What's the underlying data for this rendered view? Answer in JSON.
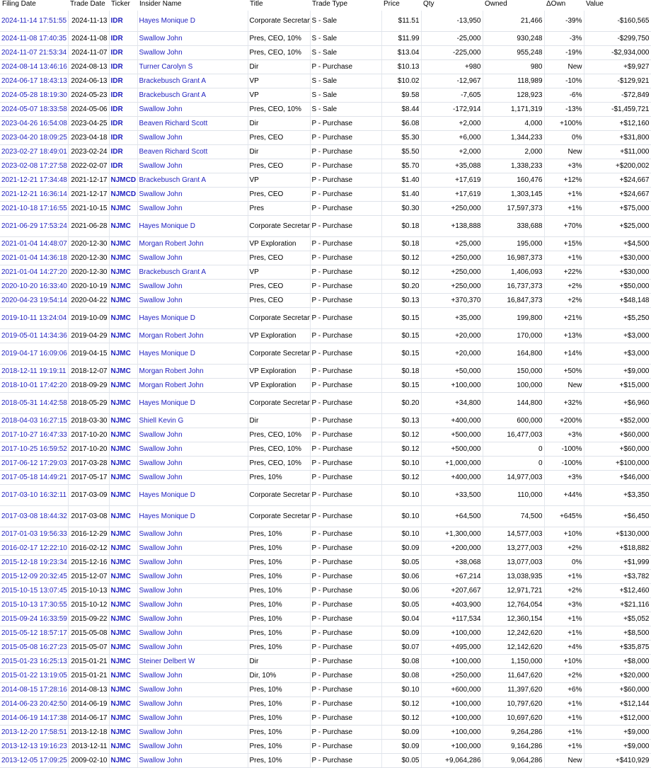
{
  "columns": [
    "Filing Date",
    "Trade Date",
    "Ticker",
    "Insider Name",
    "Title",
    "Trade Type",
    "Price",
    "Qty",
    "Owned",
    "ΔOwn",
    "Value"
  ],
  "rows": [
    [
      "2024-11-14 17:51:55",
      "2024-11-13",
      "IDR",
      "Hayes Monique D",
      "Corporate Secretary",
      "S - Sale",
      "$11.51",
      "-13,950",
      "21,466",
      "-39%",
      "-$160,565"
    ],
    [
      "2024-11-08 17:40:35",
      "2024-11-08",
      "IDR",
      "Swallow John",
      "Pres, CEO, 10%",
      "S - Sale",
      "$11.99",
      "-25,000",
      "930,248",
      "-3%",
      "-$299,750"
    ],
    [
      "2024-11-07 21:53:34",
      "2024-11-07",
      "IDR",
      "Swallow John",
      "Pres, CEO, 10%",
      "S - Sale",
      "$13.04",
      "-225,000",
      "955,248",
      "-19%",
      "-$2,934,000"
    ],
    [
      "2024-08-14 13:46:16",
      "2024-08-13",
      "IDR",
      "Turner Carolyn S",
      "Dir",
      "P - Purchase",
      "$10.13",
      "+980",
      "980",
      "New",
      "+$9,927"
    ],
    [
      "2024-06-17 18:43:13",
      "2024-06-13",
      "IDR",
      "Brackebusch Grant A",
      "VP",
      "S - Sale",
      "$10.02",
      "-12,967",
      "118,989",
      "-10%",
      "-$129,921"
    ],
    [
      "2024-05-28 18:19:30",
      "2024-05-23",
      "IDR",
      "Brackebusch Grant A",
      "VP",
      "S - Sale",
      "$9.58",
      "-7,605",
      "128,923",
      "-6%",
      "-$72,849"
    ],
    [
      "2024-05-07 18:33:58",
      "2024-05-06",
      "IDR",
      "Swallow John",
      "Pres, CEO, 10%",
      "S - Sale",
      "$8.44",
      "-172,914",
      "1,171,319",
      "-13%",
      "-$1,459,721"
    ],
    [
      "2023-04-26 16:54:08",
      "2023-04-25",
      "IDR",
      "Beaven Richard Scott",
      "Dir",
      "P - Purchase",
      "$6.08",
      "+2,000",
      "4,000",
      "+100%",
      "+$12,160"
    ],
    [
      "2023-04-20 18:09:25",
      "2023-04-18",
      "IDR",
      "Swallow John",
      "Pres, CEO",
      "P - Purchase",
      "$5.30",
      "+6,000",
      "1,344,233",
      "0%",
      "+$31,800"
    ],
    [
      "2023-02-27 18:49:01",
      "2023-02-24",
      "IDR",
      "Beaven Richard Scott",
      "Dir",
      "P - Purchase",
      "$5.50",
      "+2,000",
      "2,000",
      "New",
      "+$11,000"
    ],
    [
      "2023-02-08 17:27:58",
      "2022-02-07",
      "IDR",
      "Swallow John",
      "Pres, CEO",
      "P - Purchase",
      "$5.70",
      "+35,088",
      "1,338,233",
      "+3%",
      "+$200,002"
    ],
    [
      "2021-12-21 17:34:48",
      "2021-12-17",
      "NJMCD",
      "Brackebusch Grant A",
      "VP",
      "P - Purchase",
      "$1.40",
      "+17,619",
      "160,476",
      "+12%",
      "+$24,667"
    ],
    [
      "2021-12-21 16:36:14",
      "2021-12-17",
      "NJMCD",
      "Swallow John",
      "Pres, CEO",
      "P - Purchase",
      "$1.40",
      "+17,619",
      "1,303,145",
      "+1%",
      "+$24,667"
    ],
    [
      "2021-10-18 17:16:55",
      "2021-10-15",
      "NJMC",
      "Swallow John",
      "Pres",
      "P - Purchase",
      "$0.30",
      "+250,000",
      "17,597,373",
      "+1%",
      "+$75,000"
    ],
    [
      "2021-06-29 17:53:24",
      "2021-06-28",
      "NJMC",
      "Hayes Monique D",
      "Corporate Secretary",
      "P - Purchase",
      "$0.18",
      "+138,888",
      "338,688",
      "+70%",
      "+$25,000"
    ],
    [
      "2021-01-04 14:48:07",
      "2020-12-30",
      "NJMC",
      "Morgan Robert John",
      "VP Exploration",
      "P - Purchase",
      "$0.18",
      "+25,000",
      "195,000",
      "+15%",
      "+$4,500"
    ],
    [
      "2021-01-04 14:36:18",
      "2020-12-30",
      "NJMC",
      "Swallow John",
      "Pres, CEO",
      "P - Purchase",
      "$0.12",
      "+250,000",
      "16,987,373",
      "+1%",
      "+$30,000"
    ],
    [
      "2021-01-04 14:27:20",
      "2020-12-30",
      "NJMC",
      "Brackebusch Grant A",
      "VP",
      "P - Purchase",
      "$0.12",
      "+250,000",
      "1,406,093",
      "+22%",
      "+$30,000"
    ],
    [
      "2020-10-20 16:33:40",
      "2020-10-19",
      "NJMC",
      "Swallow John",
      "Pres, CEO",
      "P - Purchase",
      "$0.20",
      "+250,000",
      "16,737,373",
      "+2%",
      "+$50,000"
    ],
    [
      "2020-04-23 19:54:14",
      "2020-04-22",
      "NJMC",
      "Swallow John",
      "Pres, CEO",
      "P - Purchase",
      "$0.13",
      "+370,370",
      "16,847,373",
      "+2%",
      "+$48,148"
    ],
    [
      "2019-10-11 13:24:04",
      "2019-10-09",
      "NJMC",
      "Hayes Monique D",
      "Corporate Secretary",
      "P - Purchase",
      "$0.15",
      "+35,000",
      "199,800",
      "+21%",
      "+$5,250"
    ],
    [
      "2019-05-01 14:34:36",
      "2019-04-29",
      "NJMC",
      "Morgan Robert John",
      "VP Exploration",
      "P - Purchase",
      "$0.15",
      "+20,000",
      "170,000",
      "+13%",
      "+$3,000"
    ],
    [
      "2019-04-17 16:09:06",
      "2019-04-15",
      "NJMC",
      "Hayes Monique D",
      "Corporate Secretary",
      "P - Purchase",
      "$0.15",
      "+20,000",
      "164,800",
      "+14%",
      "+$3,000"
    ],
    [
      "2018-12-11 19:19:11",
      "2018-12-07",
      "NJMC",
      "Morgan Robert John",
      "VP Exploration",
      "P - Purchase",
      "$0.18",
      "+50,000",
      "150,000",
      "+50%",
      "+$9,000"
    ],
    [
      "2018-10-01 17:42:20",
      "2018-09-29",
      "NJMC",
      "Morgan Robert John",
      "VP Exploration",
      "P - Purchase",
      "$0.15",
      "+100,000",
      "100,000",
      "New",
      "+$15,000"
    ],
    [
      "2018-05-31 14:42:58",
      "2018-05-29",
      "NJMC",
      "Hayes Monique D",
      "Corporate Secretary",
      "P - Purchase",
      "$0.20",
      "+34,800",
      "144,800",
      "+32%",
      "+$6,960"
    ],
    [
      "2018-04-03 16:27:15",
      "2018-03-30",
      "NJMC",
      "Shiell Kevin G",
      "Dir",
      "P - Purchase",
      "$0.13",
      "+400,000",
      "600,000",
      "+200%",
      "+$52,000"
    ],
    [
      "2017-10-27 16:47:33",
      "2017-10-20",
      "NJMC",
      "Swallow John",
      "Pres, CEO, 10%",
      "P - Purchase",
      "$0.12",
      "+500,000",
      "16,477,003",
      "+3%",
      "+$60,000"
    ],
    [
      "2017-10-25 16:59:52",
      "2017-10-20",
      "NJMC",
      "Swallow John",
      "Pres, CEO, 10%",
      "P - Purchase",
      "$0.12",
      "+500,000",
      "0",
      "-100%",
      "+$60,000"
    ],
    [
      "2017-06-12 17:29:03",
      "2017-03-28",
      "NJMC",
      "Swallow John",
      "Pres, CEO, 10%",
      "P - Purchase",
      "$0.10",
      "+1,000,000",
      "0",
      "-100%",
      "+$100,000"
    ],
    [
      "2017-05-18 14:49:21",
      "2017-05-17",
      "NJMC",
      "Swallow John",
      "Pres, 10%",
      "P - Purchase",
      "$0.12",
      "+400,000",
      "14,977,003",
      "+3%",
      "+$46,000"
    ],
    [
      "2017-03-10 16:32:11",
      "2017-03-09",
      "NJMC",
      "Hayes Monique D",
      "Corporate Secretary",
      "P - Purchase",
      "$0.10",
      "+33,500",
      "110,000",
      "+44%",
      "+$3,350"
    ],
    [
      "2017-03-08 18:44:32",
      "2017-03-08",
      "NJMC",
      "Hayes Monique D",
      "Corporate Secretary",
      "P - Purchase",
      "$0.10",
      "+64,500",
      "74,500",
      "+645%",
      "+$6,450"
    ],
    [
      "2017-01-03 19:56:33",
      "2016-12-29",
      "NJMC",
      "Swallow John",
      "Pres, 10%",
      "P - Purchase",
      "$0.10",
      "+1,300,000",
      "14,577,003",
      "+10%",
      "+$130,000"
    ],
    [
      "2016-02-17 12:22:10",
      "2016-02-12",
      "NJMC",
      "Swallow John",
      "Pres, 10%",
      "P - Purchase",
      "$0.09",
      "+200,000",
      "13,277,003",
      "+2%",
      "+$18,882"
    ],
    [
      "2015-12-18 19:23:34",
      "2015-12-16",
      "NJMC",
      "Swallow John",
      "Pres, 10%",
      "P - Purchase",
      "$0.05",
      "+38,068",
      "13,077,003",
      "0%",
      "+$1,999"
    ],
    [
      "2015-12-09 20:32:45",
      "2015-12-07",
      "NJMC",
      "Swallow John",
      "Pres, 10%",
      "P - Purchase",
      "$0.06",
      "+67,214",
      "13,038,935",
      "+1%",
      "+$3,782"
    ],
    [
      "2015-10-15 13:07:45",
      "2015-10-13",
      "NJMC",
      "Swallow John",
      "Pres, 10%",
      "P - Purchase",
      "$0.06",
      "+207,667",
      "12,971,721",
      "+2%",
      "+$12,460"
    ],
    [
      "2015-10-13 17:30:55",
      "2015-10-12",
      "NJMC",
      "Swallow John",
      "Pres, 10%",
      "P - Purchase",
      "$0.05",
      "+403,900",
      "12,764,054",
      "+3%",
      "+$21,116"
    ],
    [
      "2015-09-24 16:33:59",
      "2015-09-22",
      "NJMC",
      "Swallow John",
      "Pres, 10%",
      "P - Purchase",
      "$0.04",
      "+117,534",
      "12,360,154",
      "+1%",
      "+$5,052"
    ],
    [
      "2015-05-12 18:57:17",
      "2015-05-08",
      "NJMC",
      "Swallow John",
      "Pres, 10%",
      "P - Purchase",
      "$0.09",
      "+100,000",
      "12,242,620",
      "+1%",
      "+$8,500"
    ],
    [
      "2015-05-08 16:27:23",
      "2015-05-07",
      "NJMC",
      "Swallow John",
      "Pres, 10%",
      "P - Purchase",
      "$0.07",
      "+495,000",
      "12,142,620",
      "+4%",
      "+$35,875"
    ],
    [
      "2015-01-23 16:25:13",
      "2015-01-21",
      "NJMC",
      "Steiner Delbert W",
      "Dir",
      "P - Purchase",
      "$0.08",
      "+100,000",
      "1,150,000",
      "+10%",
      "+$8,000"
    ],
    [
      "2015-01-22 13:19:05",
      "2015-01-21",
      "NJMC",
      "Swallow John",
      "Dir, 10%",
      "P - Purchase",
      "$0.08",
      "+250,000",
      "11,647,620",
      "+2%",
      "+$20,000"
    ],
    [
      "2014-08-15 17:28:16",
      "2014-08-13",
      "NJMC",
      "Swallow John",
      "Pres, 10%",
      "P - Purchase",
      "$0.10",
      "+600,000",
      "11,397,620",
      "+6%",
      "+$60,000"
    ],
    [
      "2014-06-23 20:42:50",
      "2014-06-19",
      "NJMC",
      "Swallow John",
      "Pres, 10%",
      "P - Purchase",
      "$0.12",
      "+100,000",
      "10,797,620",
      "+1%",
      "+$12,144"
    ],
    [
      "2014-06-19 14:17:38",
      "2014-06-17",
      "NJMC",
      "Swallow John",
      "Pres, 10%",
      "P - Purchase",
      "$0.12",
      "+100,000",
      "10,697,620",
      "+1%",
      "+$12,000"
    ],
    [
      "2013-12-20 17:58:51",
      "2013-12-18",
      "NJMC",
      "Swallow John",
      "Pres, 10%",
      "P - Purchase",
      "$0.09",
      "+100,000",
      "9,264,286",
      "+1%",
      "+$9,000"
    ],
    [
      "2013-12-13 19:16:23",
      "2013-12-11",
      "NJMC",
      "Swallow John",
      "Pres, 10%",
      "P - Purchase",
      "$0.09",
      "+100,000",
      "9,164,286",
      "+1%",
      "+$9,000"
    ],
    [
      "2013-12-05 17:09:25",
      "2009-02-10",
      "NJMC",
      "Swallow John",
      "Pres, 10%",
      "P - Purchase",
      "$0.05",
      "+9,064,286",
      "9,064,286",
      "New",
      "+$410,929"
    ]
  ]
}
